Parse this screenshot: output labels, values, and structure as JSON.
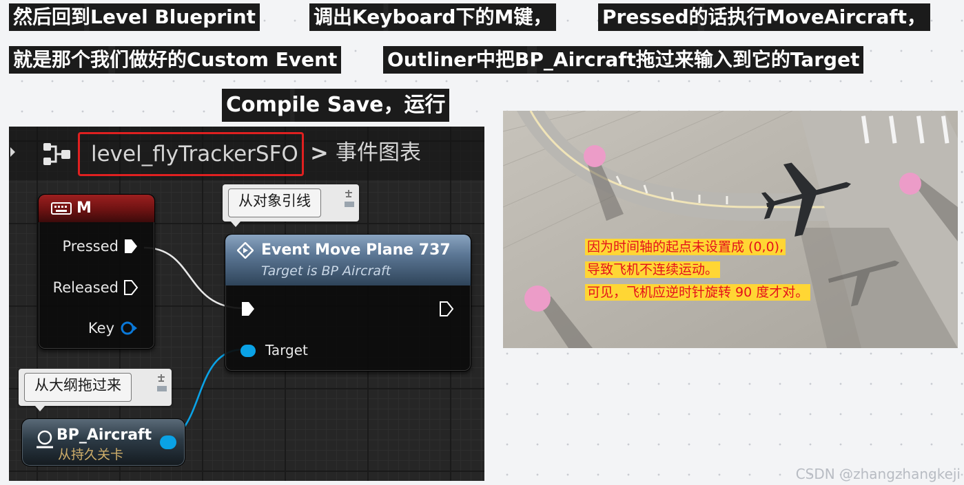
{
  "captions": [
    "然后回到Level Blueprint",
    "调出Keyboard下的M键，",
    "Pressed的话执行MoveAircraft，",
    "就是那个我们做好的Custom Event",
    "Outliner中把BP_Aircraft拖过来输入到它的Target",
    "Compile Save，运行"
  ],
  "blueprint": {
    "level_name": "level_flyTrackerSFO",
    "breadcrumb_separator": ">",
    "graph_name": "事件图表",
    "key_node": {
      "title": "M",
      "pins": {
        "pressed": "Pressed",
        "released": "Released",
        "key": "Key"
      }
    },
    "event_node": {
      "title": "Event Move Plane 737",
      "subtitle": "Target is BP Aircraft",
      "target_pin": "Target"
    },
    "comment_object": "从对象引线",
    "comment_outliner": "从大纲拖过来",
    "actor_node": {
      "title": "BP_Aircraft",
      "subtitle": "从持久关卡"
    }
  },
  "photo_note": [
    "因为时间轴的起点未设置成 (0,0),",
    "导致飞机不连续运动。",
    "可见，飞机应逆时针旋转 90 度才对。"
  ],
  "watermark": "CSDN @zhangzhangkeji",
  "colors": {
    "level_highlight_border": "#e02020",
    "note_text": "#e3121b",
    "note_highlight": "#ffd634",
    "object_pin": "#0aa2e6",
    "key_node_header": "#9c1f1f",
    "event_node_header": "#5b7694",
    "waypoint_marker": "#ec9cc8"
  },
  "icons": {
    "graph_icon": "blueprint-graph-icon",
    "keyboard_icon": "keyboard-icon",
    "event_icon": "event-diamond-icon",
    "actor_icon": "actor-reference-icon",
    "comment_pin_icon": "comment-pin-icon"
  }
}
